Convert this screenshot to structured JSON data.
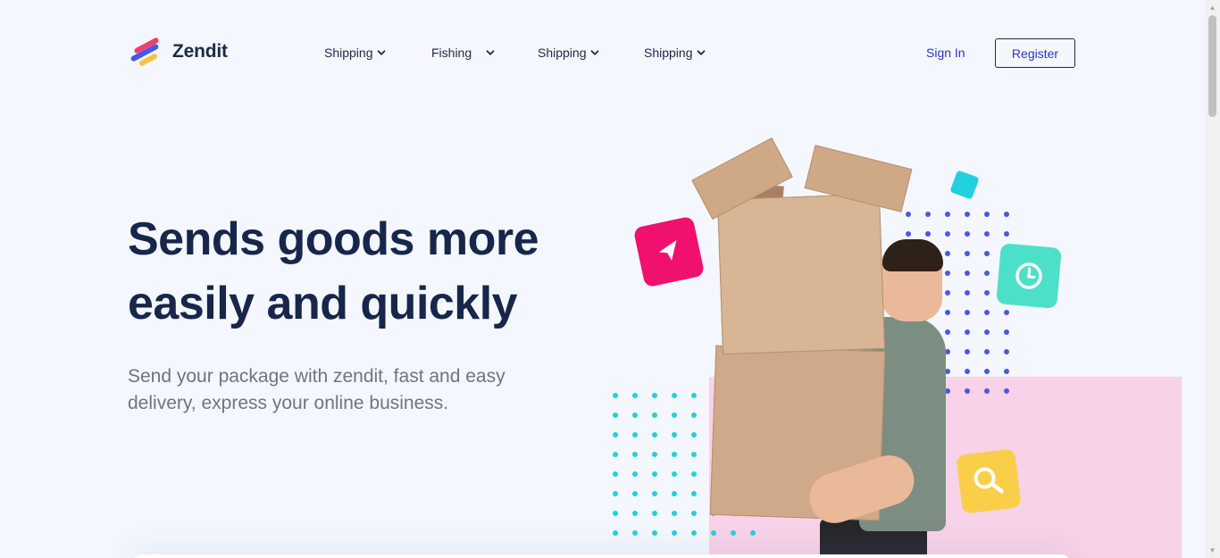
{
  "brand": {
    "name": "Zendit"
  },
  "nav": {
    "items": [
      {
        "label": "Shipping"
      },
      {
        "label": "Fishing"
      },
      {
        "label": "Shipping"
      },
      {
        "label": "Shipping"
      }
    ],
    "sign_in": "Sign In",
    "register": "Register"
  },
  "hero": {
    "title_line1": "Sends goods more",
    "title_line2": "easily and quickly",
    "subtitle_line1": "Send your package with zendit, fast and easy",
    "subtitle_line2": "delivery, express your online business."
  },
  "colors": {
    "accent": "#2c36c9",
    "title": "#17264a",
    "pink_tile": "#f0116f",
    "teal_tile": "#4de0c8",
    "yellow_tile": "#f9cf4a",
    "pink_panel": "#f7d2e8",
    "dot_blue": "#4a57e5",
    "dot_cyan": "#22d0e0"
  },
  "icons": {
    "send": "paper-plane-icon",
    "clock": "clock-icon",
    "search": "search-icon",
    "chevron": "chevron-down-icon"
  }
}
